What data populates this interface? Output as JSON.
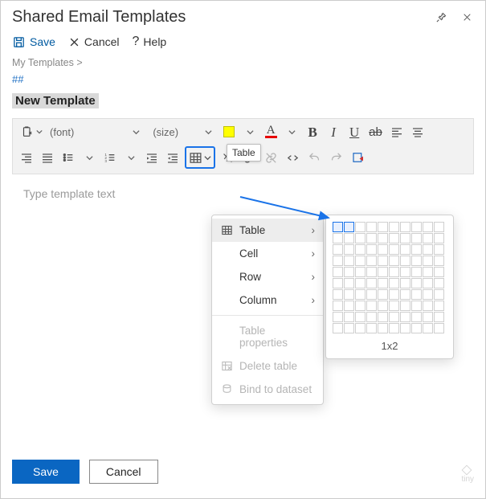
{
  "header": {
    "title": "Shared Email Templates"
  },
  "actions": {
    "save": "Save",
    "cancel": "Cancel",
    "help": "Help"
  },
  "breadcrumb": "My Templates >",
  "hash": "##",
  "template_title": "New Template",
  "toolbar": {
    "font_name_placeholder": "(font)",
    "font_size_placeholder": "(size)",
    "tooltip_table": "Table"
  },
  "editor": {
    "placeholder": "Type template text"
  },
  "dropdown": {
    "items": [
      {
        "label": "Table",
        "has_icon": true,
        "submenu": true,
        "hover": true
      },
      {
        "label": "Cell",
        "submenu": true
      },
      {
        "label": "Row",
        "submenu": true
      },
      {
        "label": "Column",
        "submenu": true
      }
    ],
    "footer_items": [
      {
        "label": "Table properties",
        "disabled": true
      },
      {
        "label": "Delete table",
        "disabled": true,
        "has_icon": true
      },
      {
        "label": "Bind to dataset",
        "disabled": true,
        "has_icon": true
      }
    ]
  },
  "grid": {
    "label": "1x2",
    "rows": 10,
    "cols": 10,
    "sel_rows": 1,
    "sel_cols": 2
  },
  "footer": {
    "save": "Save",
    "cancel": "Cancel"
  },
  "watermark": "tiny"
}
